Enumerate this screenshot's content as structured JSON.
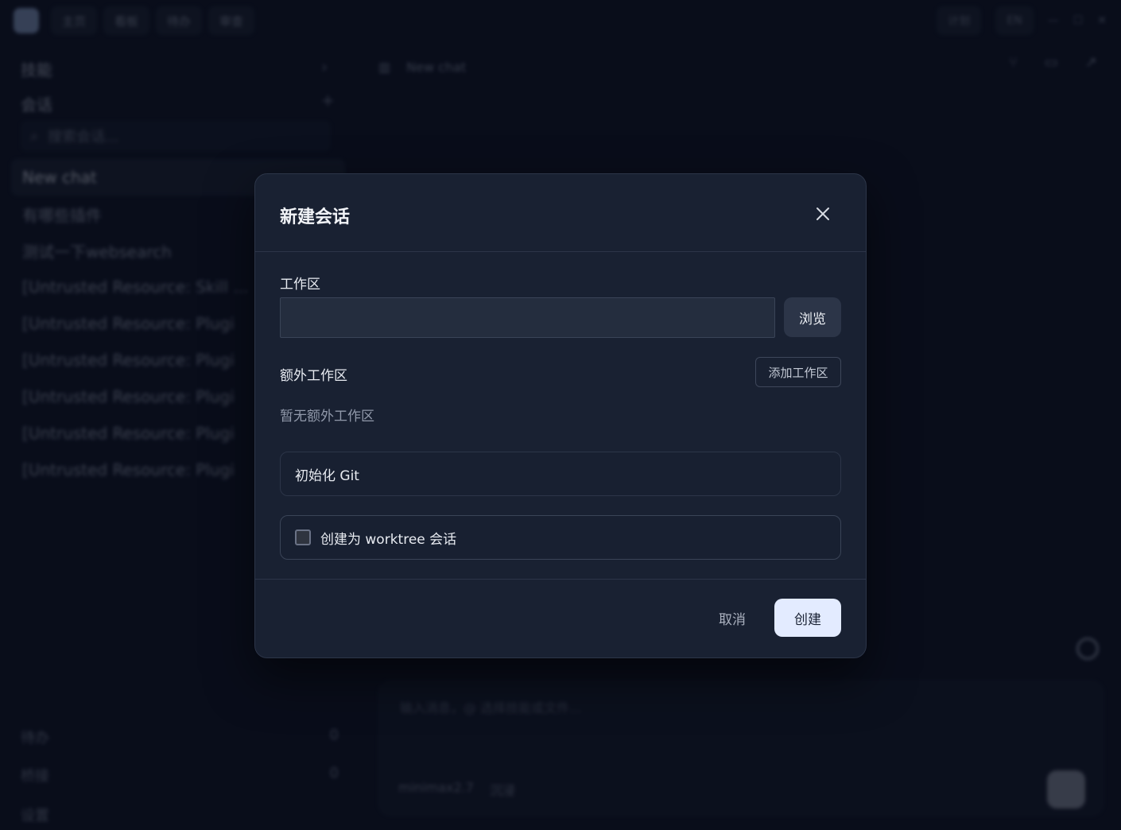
{
  "background": {
    "topbar": {
      "tabs": [
        "主页",
        "看板",
        "待办",
        "审查"
      ],
      "lang": "EN",
      "plan_label": "计划"
    },
    "sidebar": {
      "section_skills": "技能",
      "section_chats": "会话",
      "search_placeholder": "搜索会话...",
      "chats": [
        "New chat",
        "有哪些插件",
        "测试一下websearch",
        "[Untrusted Resource: Skill ...",
        "[Untrusted Resource: Plugi",
        "[Untrusted Resource: Plugi",
        "[Untrusted Resource: Plugi",
        "[Untrusted Resource: Plugi",
        "[Untrusted Resource: Plugi"
      ],
      "bottom": [
        {
          "label": "待办",
          "count": "0"
        },
        {
          "label": "桥接",
          "count": "0"
        }
      ],
      "settings": "设置"
    },
    "main": {
      "title": "New chat",
      "composer_placeholder": "输入消息，@ 选择技能或文件...",
      "model": "minimax2.7",
      "permission": "沉浸"
    }
  },
  "dialog": {
    "title": "新建会话",
    "workspace_label": "工作区",
    "workspace_value": "",
    "browse_label": "浏览",
    "extra_label": "额外工作区",
    "add_label": "添加工作区",
    "empty_text": "暂无额外工作区",
    "git_label": "初始化 Git",
    "worktree_label": "创建为 worktree 会话",
    "worktree_checked": false,
    "cancel_label": "取消",
    "create_label": "创建"
  }
}
